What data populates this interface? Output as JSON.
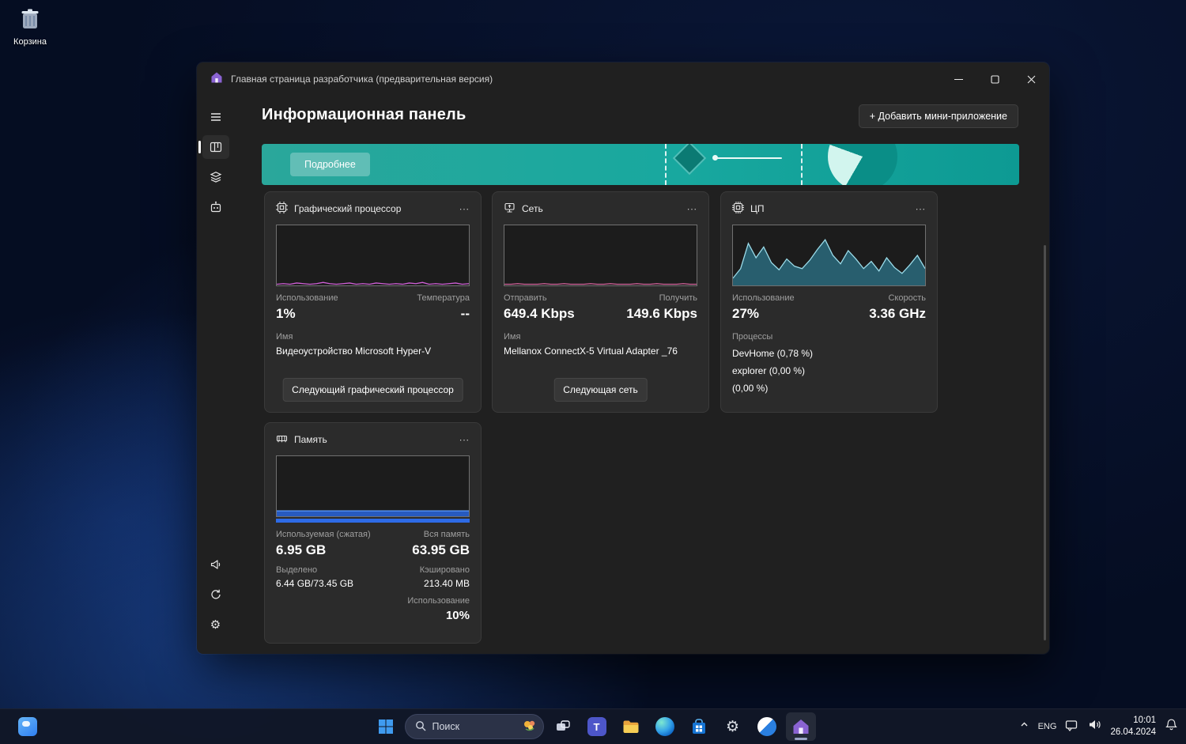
{
  "desktop": {
    "recycle_bin_label": "Корзина"
  },
  "window": {
    "title": "Главная страница разработчика (предварительная версия)"
  },
  "header": {
    "title": "Информационная панель",
    "add_widget": "+ Добавить мини-приложение"
  },
  "banner": {
    "details_button": "Подробнее"
  },
  "widgets": {
    "gpu": {
      "title": "Графический процессор",
      "menu": "∙∙∙",
      "usage_label": "Использование",
      "usage": "1%",
      "temp_label": "Температура",
      "temp": "--",
      "name_label": "Имя",
      "name": "Видеоустройство Microsoft Hyper-V",
      "button": "Следующий графический процессор"
    },
    "network": {
      "title": "Сеть",
      "menu": "∙∙∙",
      "send_label": "Отправить",
      "send": "649.4 Kbps",
      "recv_label": "Получить",
      "recv": "149.6 Kbps",
      "name_label": "Имя",
      "name": "Mellanox ConnectX-5 Virtual Adapter _76",
      "button": "Следующая сеть"
    },
    "cpu": {
      "title": "ЦП",
      "menu": "∙∙∙",
      "usage_label": "Использование",
      "usage": "27%",
      "speed_label": "Скорость",
      "speed": "3.36 GHz",
      "processes_label": "Процессы",
      "processes": [
        "DevHome (0,78 %)",
        "explorer (0,00 %)",
        "(0,00 %)"
      ]
    },
    "memory": {
      "title": "Память",
      "menu": "∙∙∙",
      "used_label": "Используемая (сжатая)",
      "used": "6.95 GB",
      "total_label": "Вся память",
      "total": "63.95 GB",
      "committed_label": "Выделено",
      "committed": "6.44 GB/73.45 GB",
      "cached_label": "Кэшировано",
      "cached": "213.40 MB",
      "usage_label": "Использование",
      "usage": "10%"
    }
  },
  "chart_data": {
    "gpu": {
      "type": "line",
      "series_name": "GPU usage %",
      "ylim": [
        0,
        100
      ],
      "color": "#cf5fd6",
      "values": [
        2,
        3,
        2,
        4,
        3,
        2,
        3,
        5,
        3,
        2,
        3,
        4,
        2,
        3,
        2,
        4,
        3,
        2,
        3,
        2,
        4,
        3,
        5,
        2,
        3,
        2,
        3,
        4,
        2,
        3
      ]
    },
    "network": {
      "type": "line",
      "series_name": "Network throughput",
      "ylim": [
        0,
        100
      ],
      "color": "#d4649c",
      "values": [
        2,
        2,
        3,
        2,
        2,
        2,
        3,
        2,
        2,
        3,
        2,
        2,
        2,
        3,
        2,
        2,
        3,
        2,
        2,
        2,
        3,
        2,
        2,
        3,
        2,
        2,
        2,
        3,
        2,
        2
      ]
    },
    "cpu": {
      "type": "area",
      "series_name": "CPU usage %",
      "ylim": [
        0,
        100
      ],
      "color": "#9bdcea",
      "fill": "rgba(47,130,155,0.65)",
      "values": [
        12,
        28,
        70,
        46,
        64,
        38,
        26,
        44,
        32,
        28,
        42,
        60,
        76,
        50,
        36,
        58,
        44,
        28,
        40,
        24,
        46,
        30,
        20,
        34,
        50,
        28
      ]
    },
    "memory": {
      "type": "area",
      "series_name": "Memory usage %",
      "ylim": [
        0,
        100
      ],
      "color": "#5b9bff",
      "fill": "rgba(41,98,210,0.9)",
      "values": [
        9,
        9,
        9,
        9,
        9,
        9,
        9,
        9,
        9,
        9,
        9,
        9,
        9,
        9,
        9,
        9,
        9,
        9,
        9,
        9
      ]
    }
  },
  "taskbar": {
    "search_placeholder": "Поиск",
    "tray": {
      "language": "ENG",
      "time": "10:01",
      "date": "26.04.2024"
    }
  }
}
